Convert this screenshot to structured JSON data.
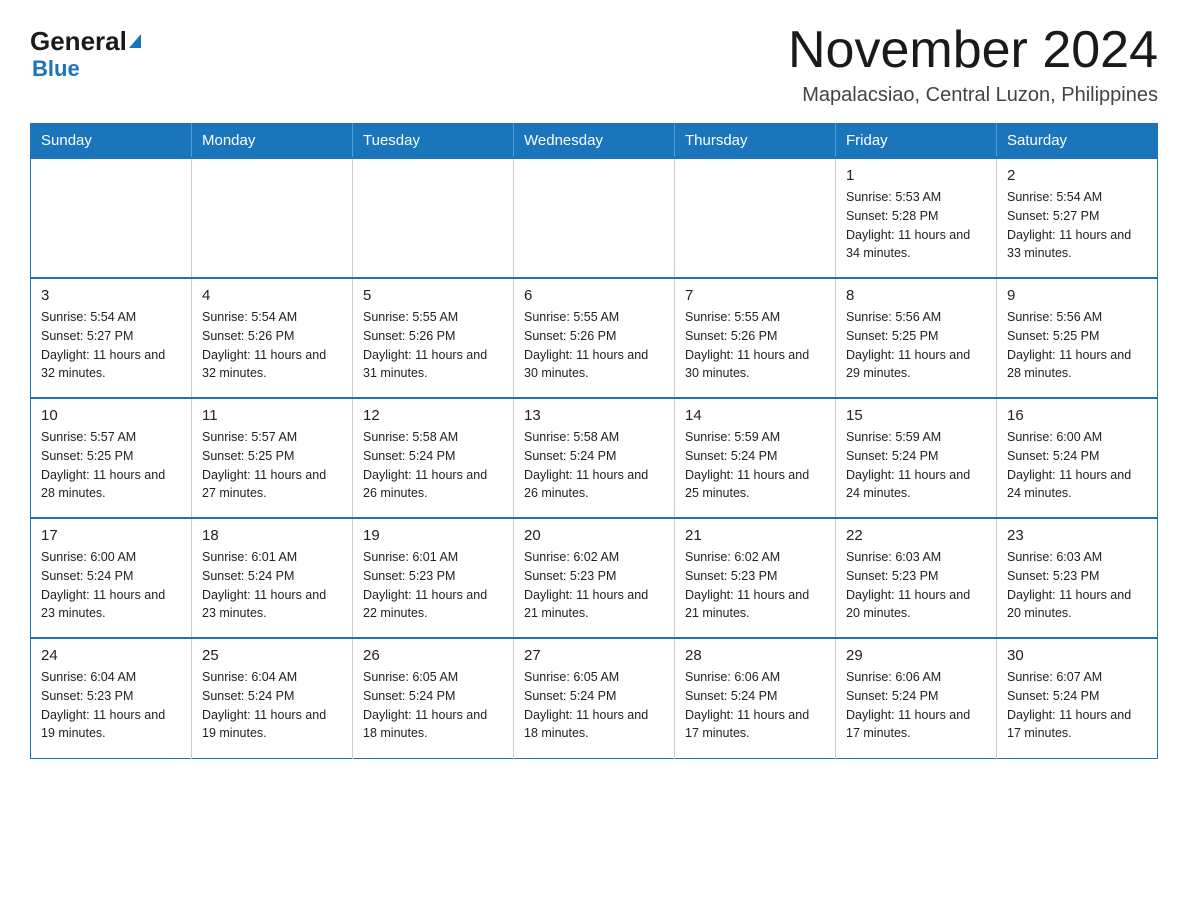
{
  "header": {
    "logo_general": "General",
    "logo_blue": "Blue",
    "title": "November 2024",
    "subtitle": "Mapalacsiao, Central Luzon, Philippines"
  },
  "days_of_week": [
    "Sunday",
    "Monday",
    "Tuesday",
    "Wednesday",
    "Thursday",
    "Friday",
    "Saturday"
  ],
  "weeks": [
    [
      {
        "day": "",
        "info": ""
      },
      {
        "day": "",
        "info": ""
      },
      {
        "day": "",
        "info": ""
      },
      {
        "day": "",
        "info": ""
      },
      {
        "day": "",
        "info": ""
      },
      {
        "day": "1",
        "info": "Sunrise: 5:53 AM\nSunset: 5:28 PM\nDaylight: 11 hours and 34 minutes."
      },
      {
        "day": "2",
        "info": "Sunrise: 5:54 AM\nSunset: 5:27 PM\nDaylight: 11 hours and 33 minutes."
      }
    ],
    [
      {
        "day": "3",
        "info": "Sunrise: 5:54 AM\nSunset: 5:27 PM\nDaylight: 11 hours and 32 minutes."
      },
      {
        "day": "4",
        "info": "Sunrise: 5:54 AM\nSunset: 5:26 PM\nDaylight: 11 hours and 32 minutes."
      },
      {
        "day": "5",
        "info": "Sunrise: 5:55 AM\nSunset: 5:26 PM\nDaylight: 11 hours and 31 minutes."
      },
      {
        "day": "6",
        "info": "Sunrise: 5:55 AM\nSunset: 5:26 PM\nDaylight: 11 hours and 30 minutes."
      },
      {
        "day": "7",
        "info": "Sunrise: 5:55 AM\nSunset: 5:26 PM\nDaylight: 11 hours and 30 minutes."
      },
      {
        "day": "8",
        "info": "Sunrise: 5:56 AM\nSunset: 5:25 PM\nDaylight: 11 hours and 29 minutes."
      },
      {
        "day": "9",
        "info": "Sunrise: 5:56 AM\nSunset: 5:25 PM\nDaylight: 11 hours and 28 minutes."
      }
    ],
    [
      {
        "day": "10",
        "info": "Sunrise: 5:57 AM\nSunset: 5:25 PM\nDaylight: 11 hours and 28 minutes."
      },
      {
        "day": "11",
        "info": "Sunrise: 5:57 AM\nSunset: 5:25 PM\nDaylight: 11 hours and 27 minutes."
      },
      {
        "day": "12",
        "info": "Sunrise: 5:58 AM\nSunset: 5:24 PM\nDaylight: 11 hours and 26 minutes."
      },
      {
        "day": "13",
        "info": "Sunrise: 5:58 AM\nSunset: 5:24 PM\nDaylight: 11 hours and 26 minutes."
      },
      {
        "day": "14",
        "info": "Sunrise: 5:59 AM\nSunset: 5:24 PM\nDaylight: 11 hours and 25 minutes."
      },
      {
        "day": "15",
        "info": "Sunrise: 5:59 AM\nSunset: 5:24 PM\nDaylight: 11 hours and 24 minutes."
      },
      {
        "day": "16",
        "info": "Sunrise: 6:00 AM\nSunset: 5:24 PM\nDaylight: 11 hours and 24 minutes."
      }
    ],
    [
      {
        "day": "17",
        "info": "Sunrise: 6:00 AM\nSunset: 5:24 PM\nDaylight: 11 hours and 23 minutes."
      },
      {
        "day": "18",
        "info": "Sunrise: 6:01 AM\nSunset: 5:24 PM\nDaylight: 11 hours and 23 minutes."
      },
      {
        "day": "19",
        "info": "Sunrise: 6:01 AM\nSunset: 5:23 PM\nDaylight: 11 hours and 22 minutes."
      },
      {
        "day": "20",
        "info": "Sunrise: 6:02 AM\nSunset: 5:23 PM\nDaylight: 11 hours and 21 minutes."
      },
      {
        "day": "21",
        "info": "Sunrise: 6:02 AM\nSunset: 5:23 PM\nDaylight: 11 hours and 21 minutes."
      },
      {
        "day": "22",
        "info": "Sunrise: 6:03 AM\nSunset: 5:23 PM\nDaylight: 11 hours and 20 minutes."
      },
      {
        "day": "23",
        "info": "Sunrise: 6:03 AM\nSunset: 5:23 PM\nDaylight: 11 hours and 20 minutes."
      }
    ],
    [
      {
        "day": "24",
        "info": "Sunrise: 6:04 AM\nSunset: 5:23 PM\nDaylight: 11 hours and 19 minutes."
      },
      {
        "day": "25",
        "info": "Sunrise: 6:04 AM\nSunset: 5:24 PM\nDaylight: 11 hours and 19 minutes."
      },
      {
        "day": "26",
        "info": "Sunrise: 6:05 AM\nSunset: 5:24 PM\nDaylight: 11 hours and 18 minutes."
      },
      {
        "day": "27",
        "info": "Sunrise: 6:05 AM\nSunset: 5:24 PM\nDaylight: 11 hours and 18 minutes."
      },
      {
        "day": "28",
        "info": "Sunrise: 6:06 AM\nSunset: 5:24 PM\nDaylight: 11 hours and 17 minutes."
      },
      {
        "day": "29",
        "info": "Sunrise: 6:06 AM\nSunset: 5:24 PM\nDaylight: 11 hours and 17 minutes."
      },
      {
        "day": "30",
        "info": "Sunrise: 6:07 AM\nSunset: 5:24 PM\nDaylight: 11 hours and 17 minutes."
      }
    ]
  ]
}
